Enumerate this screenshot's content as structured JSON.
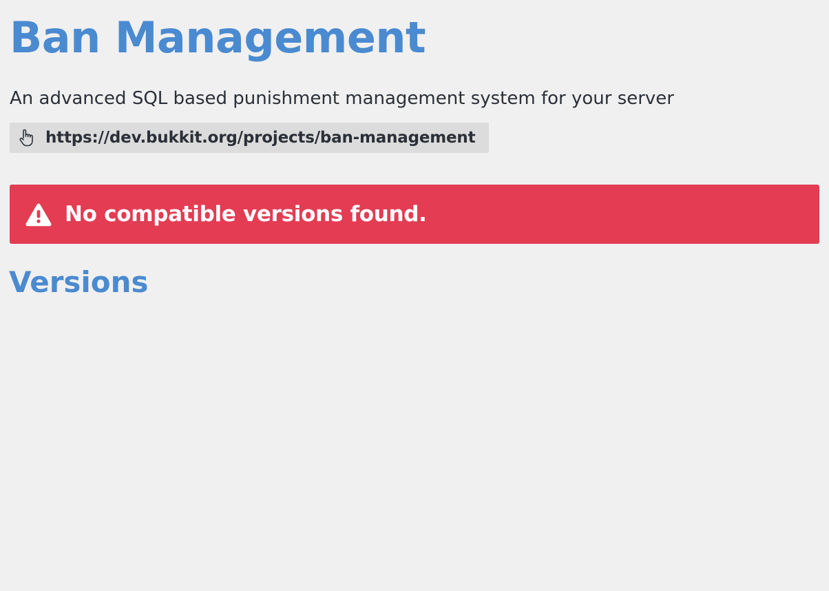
{
  "project": {
    "title": "Ban Management",
    "description": "An advanced SQL based punishment management system for your server",
    "url": "https://dev.bukkit.org/projects/ban-management",
    "url_icon": "pointer-hand-icon"
  },
  "alert": {
    "icon": "warning-triangle-icon",
    "message": "No compatible versions found.",
    "color": "#e33c53"
  },
  "versions": {
    "heading": "Versions",
    "items": []
  },
  "colors": {
    "accent": "#4a8ad0",
    "background": "#f0f0f0",
    "chip_background": "#dcdcdc",
    "text": "#2b3038"
  }
}
